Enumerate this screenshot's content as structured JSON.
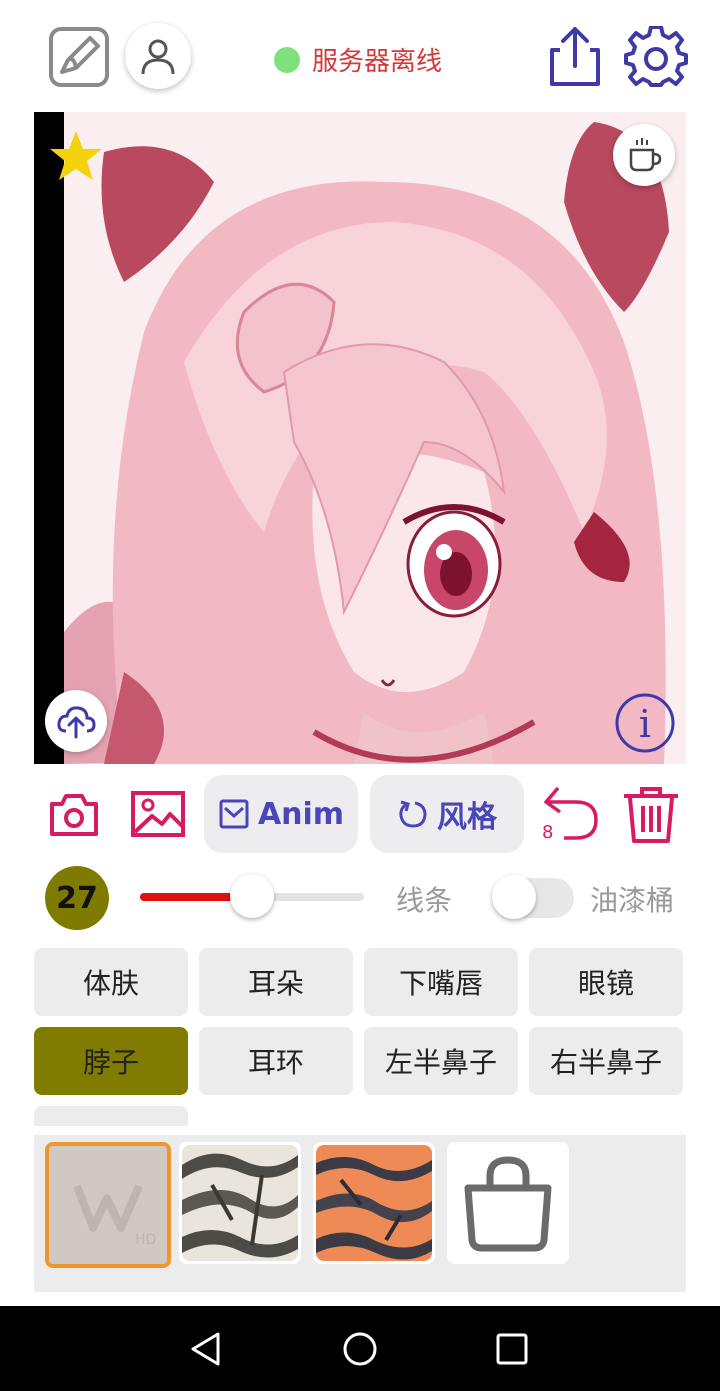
{
  "header": {
    "status_text": "服务器离线",
    "status_color": "#7de27d",
    "accent": "#3f3aa8",
    "icons": [
      "draw-icon",
      "user-icon",
      "share-icon",
      "gear-icon"
    ]
  },
  "canvas": {
    "icons": [
      "star-icon",
      "coffee-icon",
      "cloud-upload-icon",
      "info-icon"
    ],
    "favorite_color": "#f4d20c"
  },
  "toolbar": {
    "anim_label": "Anim",
    "style_label": "风格",
    "undo_count": "8",
    "icon_color": "#d81b60",
    "icons": [
      "camera-icon",
      "image-icon",
      "checkbox-icon",
      "refresh-icon",
      "undo-icon",
      "trash-icon"
    ]
  },
  "brush": {
    "size": "27",
    "size_color": "#7f7a00",
    "slider_fill_color": "#e01010",
    "slider_level": 0.5,
    "line_label": "线条",
    "fill_label": "油漆桶",
    "fill_toggle_on": false
  },
  "categories": {
    "row1": [
      "体肤",
      "耳朵",
      "下嘴唇",
      "眼镜"
    ],
    "row2": [
      "脖子",
      "耳环",
      "左半鼻子",
      "右半鼻子"
    ],
    "selected": "脖子",
    "selected_color": "#807c00"
  },
  "textures": {
    "items": [
      "blank-texture-watermark",
      "zebra-gray-texture",
      "tiger-orange-texture",
      "shop-bag-icon"
    ],
    "selected_border": "#f0962e"
  },
  "navbar": {
    "icons": [
      "back-icon",
      "home-icon",
      "recents-icon"
    ]
  }
}
